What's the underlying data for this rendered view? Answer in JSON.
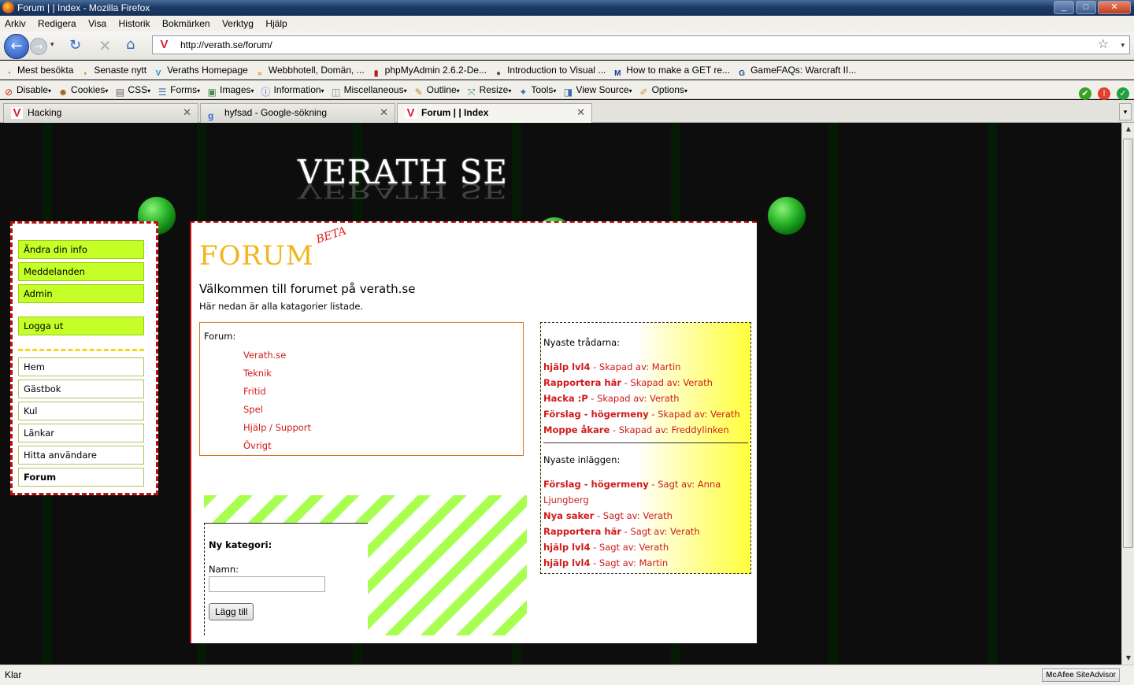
{
  "window": {
    "title": "Forum | | Index - Mozilla Firefox",
    "controls": {
      "minimize": "_",
      "maximize": "□",
      "close": "✕"
    }
  },
  "menubar": [
    "Arkiv",
    "Redigera",
    "Visa",
    "Historik",
    "Bokmärken",
    "Verktyg",
    "Hjälp"
  ],
  "nav": {
    "url": "http://verath.se/forum/",
    "back_icon": "←",
    "forward_icon": "→",
    "reload_icon": "↻",
    "stop_icon": "✕",
    "home_icon": "⌂",
    "star_icon": "☆",
    "dropdown_icon": "▾",
    "favicon": "V"
  },
  "bookmarks": [
    {
      "label": "Mest besökta",
      "icon": "clock-icon",
      "glyph": "◔",
      "color": "#c0701a"
    },
    {
      "label": "Senaste nytt",
      "icon": "rss-icon",
      "glyph": "◗",
      "color": "#f08a00"
    },
    {
      "label": "Veraths Homepage",
      "icon": "verath-icon",
      "glyph": "V",
      "color": "#1a8fc8"
    },
    {
      "label": "Webbhotell, Domän, ...",
      "icon": "rss-feed-icon",
      "glyph": "»",
      "color": "#f08a00"
    },
    {
      "label": "phpMyAdmin 2.6.2-De...",
      "icon": "phpmyadmin-icon",
      "glyph": "▮",
      "color": "#c01818"
    },
    {
      "label": "Introduction to Visual ...",
      "icon": "visual-icon",
      "glyph": "●",
      "color": "#555"
    },
    {
      "label": "How to make a GET re...",
      "icon": "msdn-icon",
      "glyph": "M",
      "color": "#1a3a8a"
    },
    {
      "label": "GameFAQs: Warcraft II...",
      "icon": "gamefaqs-icon",
      "glyph": "G",
      "color": "#1a4a9a"
    }
  ],
  "devtools": {
    "items": [
      {
        "label": "Disable",
        "glyph": "⊘",
        "color": "#d02020"
      },
      {
        "label": "Cookies",
        "glyph": "☻",
        "color": "#a06020"
      },
      {
        "label": "CSS",
        "glyph": "▤",
        "color": "#666"
      },
      {
        "label": "Forms",
        "glyph": "☰",
        "color": "#3a6ab0"
      },
      {
        "label": "Images",
        "glyph": "▣",
        "color": "#4a8a4a"
      },
      {
        "label": "Information",
        "glyph": "ⓘ",
        "color": "#3a5ab0"
      },
      {
        "label": "Miscellaneous",
        "glyph": "◫",
        "color": "#888"
      },
      {
        "label": "Outline",
        "glyph": "✎",
        "color": "#c08020"
      },
      {
        "label": "Resize",
        "glyph": "⤧",
        "color": "#3a8a3a"
      },
      {
        "label": "Tools",
        "glyph": "✦",
        "color": "#3a6ab0"
      },
      {
        "label": "View Source",
        "glyph": "◨",
        "color": "#3a6ab0"
      },
      {
        "label": "Options",
        "glyph": "✐",
        "color": "#c0a020"
      }
    ],
    "status_icons": [
      {
        "name": "valid-check-icon",
        "glyph": "✔",
        "color": "#3aa020"
      },
      {
        "name": "error-icon",
        "glyph": "!",
        "color": "#e04030"
      },
      {
        "name": "ok-icon",
        "glyph": "✓",
        "color": "#20a040"
      }
    ],
    "dropdown_marker": "▾"
  },
  "tabs": [
    {
      "label": "Hacking",
      "icon": "verath-icon",
      "active": false
    },
    {
      "label": "hyfsad - Google-sökning",
      "icon": "google-icon",
      "active": false
    },
    {
      "label": "Forum | | Index",
      "icon": "verath-icon",
      "active": true
    }
  ],
  "tab_close": "✕",
  "page": {
    "site_title": "VERATH SE",
    "left_menu": {
      "top_items": [
        "Ändra din info",
        "Meddelanden",
        "Admin"
      ],
      "logout": "Logga ut",
      "nav_items": [
        "Hem",
        "Gästbok",
        "Kul",
        "Länkar",
        "Hitta användare",
        "Forum"
      ],
      "active_item": "Forum"
    },
    "forum_title": "FORUM",
    "beta_label": "BETA",
    "welcome": "Välkommen till forumet på verath.se",
    "subwelcome": "Här nedan är alla katagorier listade.",
    "categories_label": "Forum:",
    "categories": [
      "Verath.se",
      "Teknik",
      "Fritid",
      "Spel",
      "Hjälp / Support",
      "Övrigt"
    ],
    "latest_threads_label": "Nyaste trådarna:",
    "latest_threads": [
      {
        "title": "hjälp lvl4",
        "meta": " - Skapad av: Martin"
      },
      {
        "title": "Rapportera här",
        "meta": " - Skapad av: Verath"
      },
      {
        "title": "Hacka :P",
        "meta": " - Skapad av: Verath"
      },
      {
        "title": "Förslag - högermeny",
        "meta": " - Skapad av: Verath"
      },
      {
        "title": "Moppe åkare",
        "meta": " - Skapad av: Freddylinken"
      }
    ],
    "latest_posts_label": "Nyaste inläggen:",
    "latest_posts": [
      {
        "title": "Förslag - högermeny",
        "meta": " - Sagt av: Anna Ljungberg"
      },
      {
        "title": "Nya saker",
        "meta": " - Sagt av: Verath"
      },
      {
        "title": "Rapportera här",
        "meta": " - Sagt av: Verath"
      },
      {
        "title": "hjälp lvl4",
        "meta": " - Sagt av: Verath"
      },
      {
        "title": "hjälp lvl4",
        "meta": " - Sagt av: Martin"
      }
    ],
    "new_category": {
      "heading": "Ny kategori:",
      "name_label": "Namn:",
      "name_value": "",
      "submit": "Lägg till"
    }
  },
  "scrollbar": {
    "up": "▲",
    "down": "▼"
  },
  "status": {
    "text": "Klar",
    "mcafee_brand": "McAfee",
    "mcafee_product": "SiteAdvisor"
  }
}
